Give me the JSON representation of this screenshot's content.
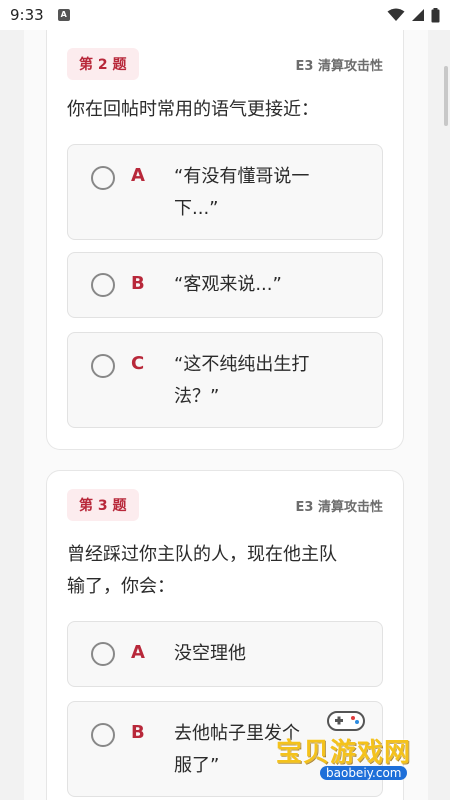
{
  "status": {
    "time": "9:33",
    "notif_icon": "A"
  },
  "questions": [
    {
      "badge": "第 2 题",
      "tag": "E3 清算攻击性",
      "text": "你在回帖时常用的语气更接近：",
      "options": [
        {
          "letter": "A",
          "line1": "“有没有懂哥说一",
          "line2": "下...”"
        },
        {
          "letter": "B",
          "line1": "“客观来说...”"
        },
        {
          "letter": "C",
          "line1": "“这不纯纯出生打",
          "line2": "法？”"
        }
      ]
    },
    {
      "badge": "第 3 题",
      "tag": "E3 清算攻击性",
      "text_line1": "曾经踩过你主队的人，现在他主队",
      "text_line2": "输了，你会：",
      "options": [
        {
          "letter": "A",
          "line1": "没空理他"
        },
        {
          "letter": "B",
          "line1": "去他帖子里发个",
          "line2": "服了”"
        }
      ]
    }
  ],
  "watermark": {
    "text": "宝贝游戏网",
    "url": "baobeiy.com"
  }
}
